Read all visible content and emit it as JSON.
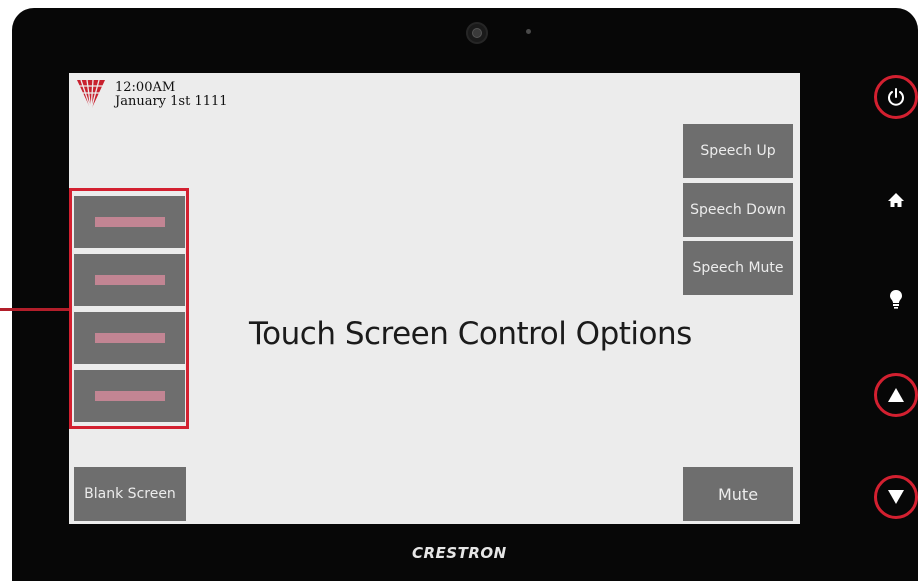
{
  "status": {
    "time": "12:00AM",
    "date": "January 1st 1111"
  },
  "main": {
    "title": "Touch Screen Control Options"
  },
  "buttons": {
    "speech_up": "Speech Up",
    "speech_down": "Speech Down",
    "speech_mute": "Speech Mute",
    "blank_screen": "Blank Screen",
    "mute": "Mute"
  },
  "hardware": {
    "brand": "CRESTRON",
    "icons": [
      "power-icon",
      "home-icon",
      "lightbulb-icon",
      "up-arrow-icon",
      "down-arrow-icon"
    ]
  },
  "colors": {
    "highlight": "#d32030",
    "button_gray": "#6e6e6e",
    "placeholder_pink": "#c28593",
    "screen_bg": "#ececec"
  }
}
